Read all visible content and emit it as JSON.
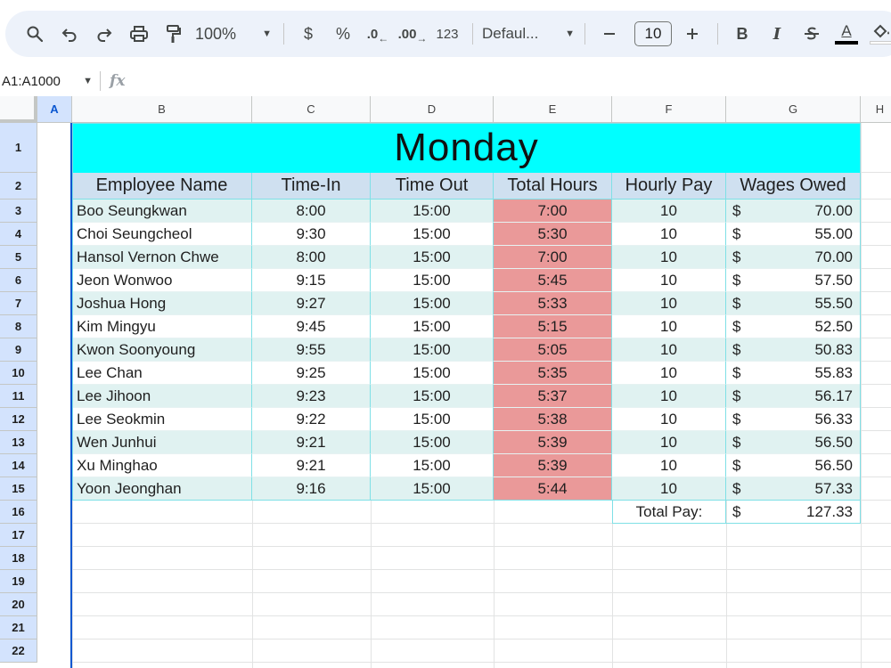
{
  "toolbar": {
    "zoom": "100%",
    "currency": "$",
    "percent": "%",
    "decrease_decimal": ".0",
    "increase_decimal": ".00",
    "number_format": "123",
    "font": "Defaul...",
    "font_size": "10",
    "bold": "B",
    "italic": "I",
    "text_color_letter": "A",
    "icons": [
      "search-icon",
      "undo-icon",
      "redo-icon",
      "print-icon",
      "paint-format-icon",
      "minus-icon",
      "plus-icon",
      "strikethrough-icon",
      "fill-color-icon"
    ]
  },
  "formula_bar": {
    "name_box": "A1:A1000",
    "fx": "fx"
  },
  "columns": [
    "A",
    "B",
    "C",
    "D",
    "E",
    "F",
    "G",
    "H"
  ],
  "rows": [
    "1",
    "2",
    "3",
    "4",
    "5",
    "6",
    "7",
    "8",
    "9",
    "10",
    "11",
    "12",
    "13",
    "14",
    "15",
    "16",
    "17",
    "18",
    "19",
    "20",
    "21",
    "22"
  ],
  "sheet": {
    "title": "Monday",
    "headers": [
      "Employee Name",
      "Time-In",
      "Time Out",
      "Total Hours",
      "Hourly Pay",
      "Wages Owed"
    ],
    "currency_symbol": "$",
    "employees": [
      {
        "name": "Boo Seungkwan",
        "time_in": "8:00",
        "time_out": "15:00",
        "total_hours": "7:00",
        "hourly_pay": "10",
        "wages": "70.00"
      },
      {
        "name": "Choi Seungcheol",
        "time_in": "9:30",
        "time_out": "15:00",
        "total_hours": "5:30",
        "hourly_pay": "10",
        "wages": "55.00"
      },
      {
        "name": "Hansol Vernon Chwe",
        "time_in": "8:00",
        "time_out": "15:00",
        "total_hours": "7:00",
        "hourly_pay": "10",
        "wages": "70.00"
      },
      {
        "name": "Jeon Wonwoo",
        "time_in": "9:15",
        "time_out": "15:00",
        "total_hours": "5:45",
        "hourly_pay": "10",
        "wages": "57.50"
      },
      {
        "name": "Joshua Hong",
        "time_in": "9:27",
        "time_out": "15:00",
        "total_hours": "5:33",
        "hourly_pay": "10",
        "wages": "55.50"
      },
      {
        "name": "Kim Mingyu",
        "time_in": "9:45",
        "time_out": "15:00",
        "total_hours": "5:15",
        "hourly_pay": "10",
        "wages": "52.50"
      },
      {
        "name": "Kwon Soonyoung",
        "time_in": "9:55",
        "time_out": "15:00",
        "total_hours": "5:05",
        "hourly_pay": "10",
        "wages": "50.83"
      },
      {
        "name": "Lee Chan",
        "time_in": "9:25",
        "time_out": "15:00",
        "total_hours": "5:35",
        "hourly_pay": "10",
        "wages": "55.83"
      },
      {
        "name": "Lee Jihoon",
        "time_in": "9:23",
        "time_out": "15:00",
        "total_hours": "5:37",
        "hourly_pay": "10",
        "wages": "56.17"
      },
      {
        "name": "Lee Seokmin",
        "time_in": "9:22",
        "time_out": "15:00",
        "total_hours": "5:38",
        "hourly_pay": "10",
        "wages": "56.33"
      },
      {
        "name": "Wen Junhui",
        "time_in": "9:21",
        "time_out": "15:00",
        "total_hours": "5:39",
        "hourly_pay": "10",
        "wages": "56.50"
      },
      {
        "name": "Xu Minghao",
        "time_in": "9:21",
        "time_out": "15:00",
        "total_hours": "5:39",
        "hourly_pay": "10",
        "wages": "56.50"
      },
      {
        "name": "Yoon Jeonghan",
        "time_in": "9:16",
        "time_out": "15:00",
        "total_hours": "5:44",
        "hourly_pay": "10",
        "wages": "57.33"
      }
    ],
    "total_pay_label": "Total Pay:",
    "total_pay": "127.33"
  },
  "colors": {
    "title_fill": "#00ffff",
    "header_fill": "#cfe0f0",
    "band_fill": "#e0f2f1",
    "hours_fill": "#ea9999",
    "selection": "#0b57d0"
  }
}
